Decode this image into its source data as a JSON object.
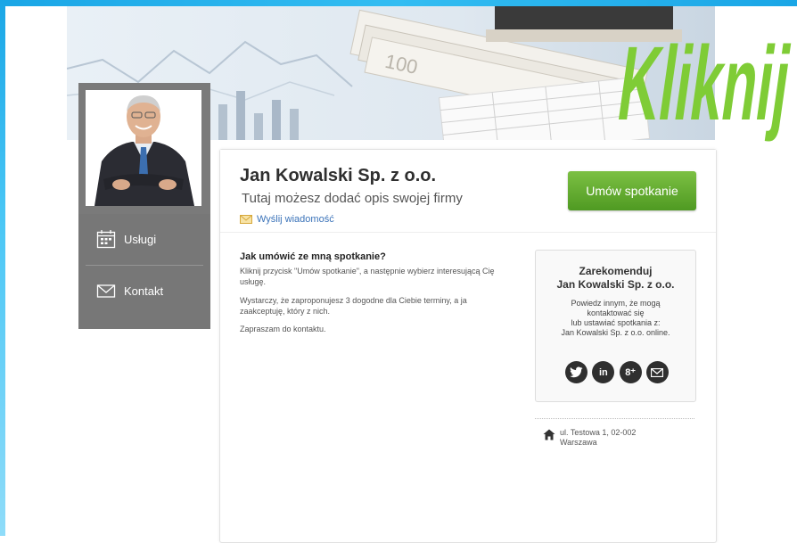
{
  "promo": {
    "label": "Kliknij"
  },
  "sidebar": {
    "items": [
      {
        "label": "Usługi",
        "icon": "calendar-icon"
      },
      {
        "label": "Kontakt",
        "icon": "envelope-icon"
      }
    ]
  },
  "header": {
    "company_name": "Jan Kowalski Sp. z o.o.",
    "description": "Tutaj możesz dodać opis swojej firmy",
    "send_message_label": "Wyślij wiadomość",
    "appointment_button_label": "Umów spotkanie"
  },
  "content": {
    "title": "Jak umówić ze mną spotkanie?",
    "paragraphs": [
      "Kliknij przycisk \"Umów spotkanie\", a następnie wybierz interesującą Cię usługę.",
      "Wystarczy, że zaproponujesz 3 dogodne dla Ciebie terminy, a ja zaakceptuję, który z nich.",
      "Zapraszam do kontaktu."
    ]
  },
  "recommend": {
    "title_line1": "Zarekomenduj",
    "title_line2": "Jan Kowalski Sp. z o.o.",
    "text_line1": "Powiedz innym, że mogą",
    "text_line2": "kontaktować się",
    "text_line3": "lub ustawiać spotkania z:",
    "text_line4": "Jan Kowalski Sp. z o.o. online.",
    "social": [
      {
        "name": "twitter-icon"
      },
      {
        "name": "linkedin-icon",
        "glyph": "in"
      },
      {
        "name": "google-plus-icon",
        "glyph": "8⁺"
      },
      {
        "name": "email-icon"
      }
    ]
  },
  "address": {
    "line1": "ul. Testowa 1, 02-002",
    "line2": "Warszawa"
  },
  "colors": {
    "accent_green": "#5ea52c",
    "promo_green": "#7fcc36",
    "frame_blue": "#1aa6e6",
    "sidebar_gray": "#777777",
    "link_blue": "#3b73b9"
  }
}
